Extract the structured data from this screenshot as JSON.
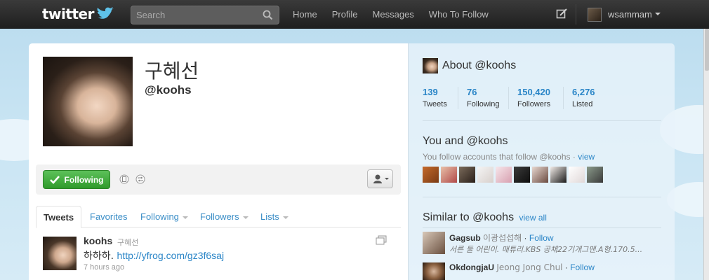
{
  "topbar": {
    "logo_text": "twitter",
    "search_placeholder": "Search",
    "nav": [
      "Home",
      "Profile",
      "Messages",
      "Who To Follow"
    ],
    "username": "wsammam"
  },
  "profile": {
    "name": "구혜선",
    "handle": "@koohs",
    "follow_button_label": "Following"
  },
  "tabs": [
    {
      "label": "Tweets",
      "active": true
    },
    {
      "label": "Favorites",
      "dropdown": false
    },
    {
      "label": "Following",
      "dropdown": true
    },
    {
      "label": "Followers",
      "dropdown": true
    },
    {
      "label": "Lists",
      "dropdown": true
    }
  ],
  "tweet": {
    "author": "koohs",
    "author_name": "구혜선",
    "text": "하하하.",
    "link": "http://yfrog.com/gz3f6saj",
    "time": "7 hours ago"
  },
  "sidebar": {
    "about_title": "About @koohs",
    "stats": [
      {
        "value": "139",
        "label": "Tweets"
      },
      {
        "value": "76",
        "label": "Following"
      },
      {
        "value": "150,420",
        "label": "Followers"
      },
      {
        "value": "6,276",
        "label": "Listed"
      }
    ],
    "you_and_title": "You and @koohs",
    "you_and_sub": "You follow accounts that follow @koohs ·",
    "you_and_view": "view",
    "similar_title": "Similar to @koohs",
    "similar_view_all": "view all",
    "similar": [
      {
        "handle": "Gagsub",
        "name": "이광섭섭해",
        "follow": "Follow",
        "bio": "서른 둘 어린이. 매튜리.KBS 공채22기개그맨.A형.170.5..."
      },
      {
        "handle": "OkdongjaU",
        "name": "Jeong Jong Chul",
        "follow": "Follow",
        "bio": ""
      }
    ]
  },
  "colors": {
    "link": "#2a85c7",
    "follow_green": "#3aa535",
    "topbar": "#2b2b2b"
  }
}
